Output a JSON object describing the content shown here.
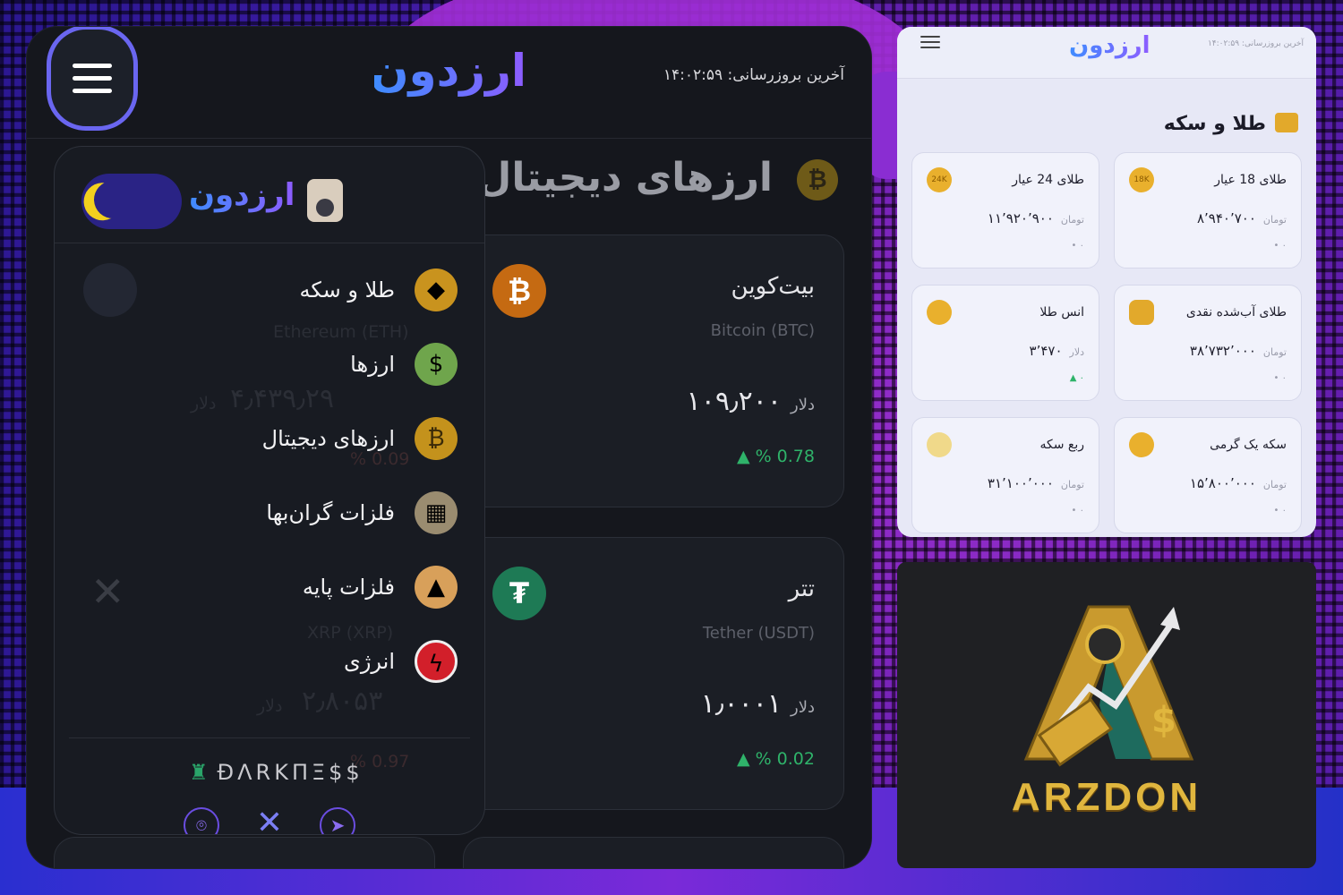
{
  "left_app": {
    "logo": "ارزدون",
    "last_update": "آخرین بروزرسانی: ۱۴:۰۲:۵۹",
    "section": {
      "title": "ارزهای دیجیتال",
      "icon": "bitcoin-icon"
    },
    "cards": [
      {
        "name": "بیت‌کوین",
        "symbol": "Bitcoin (BTC)",
        "price": "۱۰۹٫۲۰۰",
        "unit": "دلار",
        "change": "▲ % 0.78",
        "icon": "bitcoin-icon"
      },
      {
        "name": "تتر",
        "symbol": "Tether (USDT)",
        "price": "۱٫۰۰۰۱",
        "unit": "دلار",
        "change": "▲ % 0.02",
        "icon": "tether-icon"
      }
    ],
    "hidden_behind_drawer": {
      "eth_symbol": "Ethereum (ETH)",
      "eth_price": "۴٫۴۳۹٫۲۹",
      "eth_unit": "دلار",
      "eth_change": "% 0.09",
      "xrp_symbol": "XRP (XRP)",
      "xrp_price": "۲٫۸۰۵۳",
      "xrp_unit": "دلار",
      "xrp_change": "% 0.97"
    }
  },
  "drawer": {
    "logo": "ارزدون",
    "theme_toggle": "moon-icon",
    "menu": [
      {
        "label": "طلا و سکه",
        "icon": "gold-icon"
      },
      {
        "label": "ارزها",
        "icon": "cash-icon"
      },
      {
        "label": "ارزهای دیجیتال",
        "icon": "bitcoin-icon"
      },
      {
        "label": "فلزات گران‌بها",
        "icon": "metals-icon"
      },
      {
        "label": "فلزات پایه",
        "icon": "base-metal-icon"
      },
      {
        "label": "انرژی",
        "icon": "energy-icon"
      }
    ],
    "brand": "ĐΛRKΠΞ$$",
    "socials": [
      "github-icon",
      "x-icon",
      "telegram-icon"
    ]
  },
  "right_app": {
    "logo": "ارزدون",
    "last_update": "آخرین بروزرسانی: ۱۴:۰۲:۵۹",
    "section_title": "طلا و سکه",
    "cards": [
      {
        "name": "طلای 18 عیار",
        "price": "۸٬۹۴۰٬۷۰۰",
        "unit": "تومان",
        "change": "• ۰",
        "badge": "18K"
      },
      {
        "name": "طلای 24 عیار",
        "price": "۱۱٬۹۲۰٬۹۰۰",
        "unit": "تومان",
        "change": "• ۰",
        "badge": "24K"
      },
      {
        "name": "طلای آب‌شده نقدی",
        "price": "۳۸٬۷۳۲٬۰۰۰",
        "unit": "تومان",
        "change": "• ۰",
        "badge": ""
      },
      {
        "name": "انس طلا",
        "price": "۳٬۴۷۰",
        "unit": "دلار",
        "change": "▲ ۰",
        "badge": ""
      },
      {
        "name": "سکه یک گرمی",
        "price": "۱۵٬۸۰۰٬۰۰۰",
        "unit": "تومان",
        "change": "• ۰",
        "badge": ""
      },
      {
        "name": "ربع سکه",
        "price": "۳۱٬۱۰۰٬۰۰۰",
        "unit": "تومان",
        "change": "• ۰",
        "badge": ""
      }
    ]
  },
  "logo_panel": {
    "text": "ARZDON"
  },
  "colors": {
    "accent": "#6a66f0",
    "up": "#2fb36a",
    "gold": "#e0b63e"
  }
}
